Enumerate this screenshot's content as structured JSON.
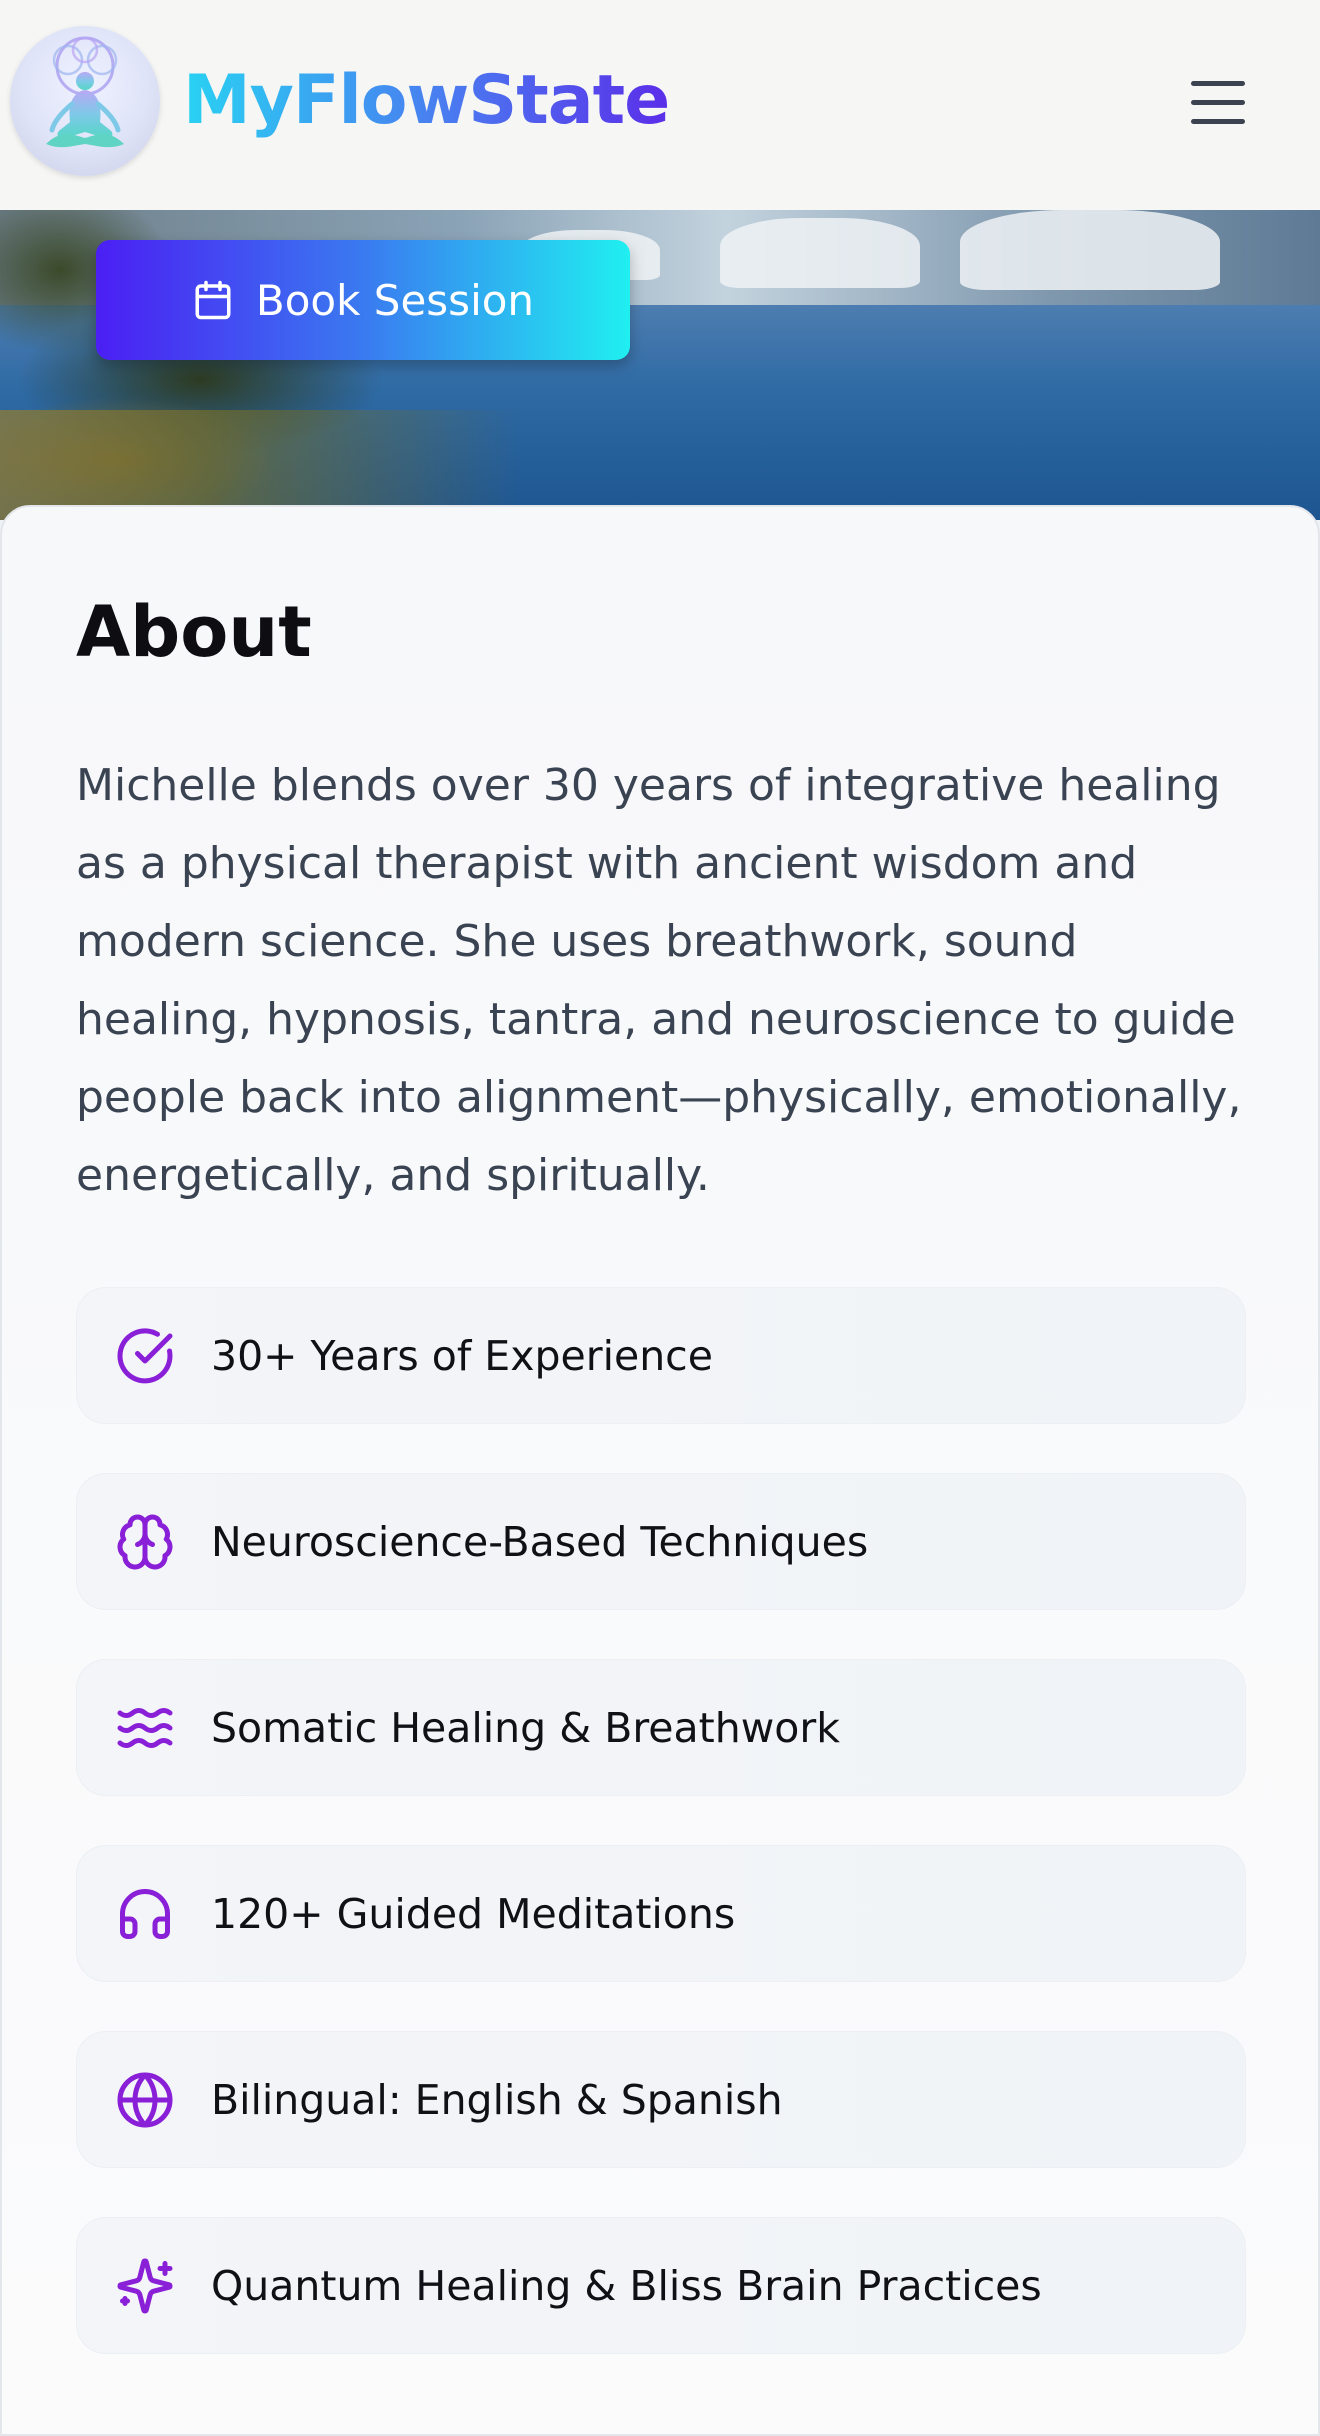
{
  "header": {
    "brand": "MyFlowState",
    "logo_icon": "meditation-tree-logo",
    "menu_icon": "hamburger-menu-icon"
  },
  "hero": {
    "book_button_label": "Book Session",
    "book_button_icon": "calendar-icon"
  },
  "about": {
    "title": "About",
    "body": "Michelle blends over 30 years of integrative healing as a physical therapist with ancient wisdom and modern science. She uses breathwork, sound healing, hypnosis, tantra, and neuroscience to guide people back into alignment—physically, emotionally, energetically, and spiritually.",
    "features": [
      {
        "icon": "check-circle-icon",
        "label": "30+ Years of Experience"
      },
      {
        "icon": "brain-icon",
        "label": "Neuroscience-Based Techniques"
      },
      {
        "icon": "waves-icon",
        "label": "Somatic Healing & Breathwork"
      },
      {
        "icon": "headphones-icon",
        "label": "120+ Guided Meditations"
      },
      {
        "icon": "globe-icon",
        "label": "Bilingual: English & Spanish"
      },
      {
        "icon": "sparkles-icon",
        "label": "Quantum Healing & Bliss Brain Practices"
      }
    ]
  },
  "colors": {
    "accent_purple": "#8a1fd8",
    "brand_gradient_start": "#29d2f2",
    "brand_gradient_end": "#5b2ee9",
    "button_gradient_start": "#4b1ff3",
    "button_gradient_end": "#20eff0"
  }
}
